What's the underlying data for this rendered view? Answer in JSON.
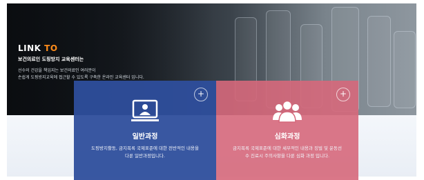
{
  "hero": {
    "heading_prefix": "LINK",
    "heading_accent": "TO",
    "subheading": "보건의료인 도핑방지 교육센터는",
    "desc_line1": "선수의 건강을 책임지는 보건의료인 여러분이",
    "desc_line2": "손쉽게 도핑방지교육에 접근할 수 있도록 구축한 온라인 교육센터 입니다."
  },
  "cards": [
    {
      "title": "일반과정",
      "description": "도핑방지활동, 금지목록 국제표준에 대한 전반적인 내용을 다룬 일반과정입니다.",
      "plus_label": "+",
      "icon": "monitor-person-icon",
      "color": "#2e4e9c"
    },
    {
      "title": "심화과정",
      "description": "금지목록 국제표준에 대한 세부적인 내용과 징벌 및 운동선수 진료시 주의사항을 다룬 심화 과정 입니다.",
      "plus_label": "+",
      "icon": "user-group-icon",
      "color": "#d6687b"
    }
  ],
  "accent_color": "#ff8c1a"
}
